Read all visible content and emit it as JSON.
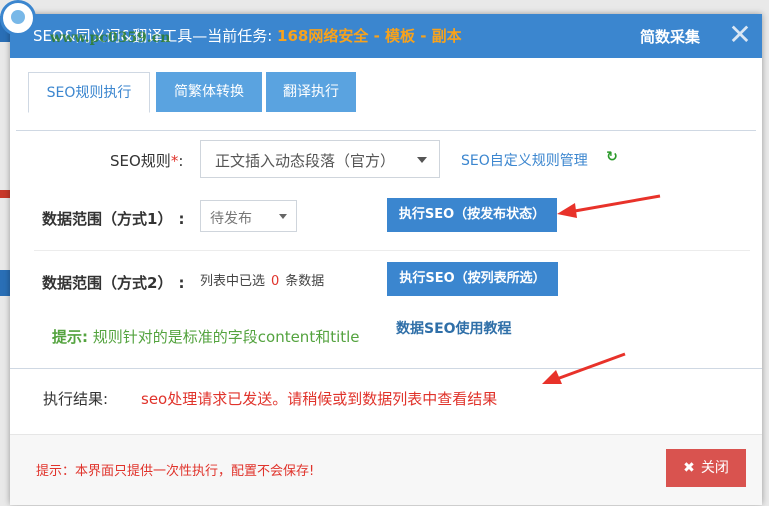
{
  "dialog": {
    "title_prefix": "SEO&同义词&翻译工具—当前任务: ",
    "title_task": "168网络安全 - 模板 - 副本",
    "collect_label": "简数采集",
    "close_glyph": "✕",
    "watermark_url": "www.pc0359.cn"
  },
  "tabs": [
    {
      "label": "SEO规则执行"
    },
    {
      "label": "简繁体转换"
    },
    {
      "label": "翻译执行"
    }
  ],
  "form": {
    "seo_rule_label": "SEO规则",
    "required_mark": "*",
    "seo_rule_suffix": ":",
    "seo_rule_value": "正文插入动态段落（官方）",
    "custom_rule_link": "SEO自定义规则管理",
    "refresh_glyph": "↻",
    "scope1_label": "数据范围（方式1）",
    "scope1_suffix": ":",
    "scope1_value": "待发布",
    "execute_btn1": "执行SEO（按发布状态）",
    "scope2_label": "数据范围（方式2）",
    "scope2_suffix": ":",
    "list_prefix": "列表中已选",
    "list_count": "0",
    "list_suffix": "条数据",
    "execute_btn2": "执行SEO（按列表所选）",
    "tip_prefix": "提示:",
    "tip_text": " 规则针对的是标准的字段content和title",
    "tutorial_link": "数据SEO使用教程"
  },
  "result": {
    "label": "执行结果:",
    "text": "seo处理请求已发送。请稍候或到数据列表中查看结果"
  },
  "footer": {
    "tip": "提示：本界面只提供一次性执行，配置不会保存!",
    "close_glyph": "✖",
    "close_label": "关闭"
  },
  "colors": {
    "titlebar": "#3b86cf",
    "task_orange": "#f7a21c",
    "accent_blue": "#3b86cf",
    "error_red": "#e0332b",
    "tip_green": "#54a33f",
    "close_button": "#d9534f"
  }
}
